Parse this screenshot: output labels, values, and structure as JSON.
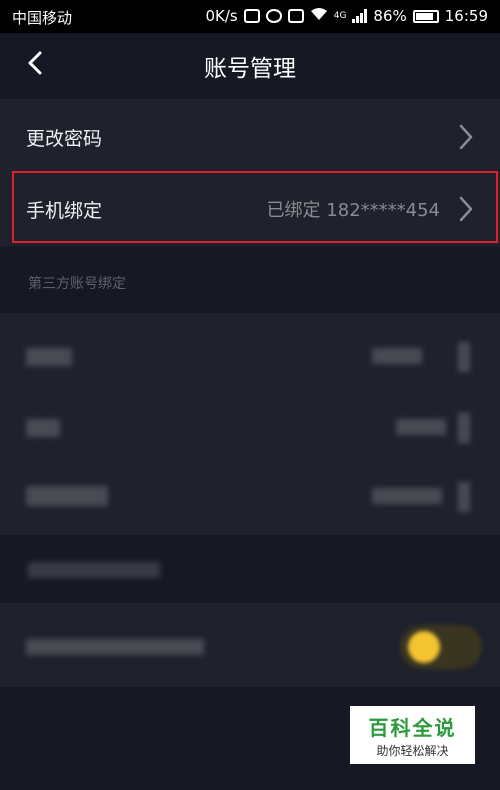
{
  "status_bar": {
    "carrier": "中国移动",
    "network_speed": "0K/s",
    "network_badge": "4G",
    "battery": "86%",
    "time": "16:59"
  },
  "nav": {
    "title": "账号管理",
    "back_icon": "chevron-left-icon"
  },
  "account_settings": {
    "change_password_label": "更改密码",
    "phone_binding_label": "手机绑定",
    "phone_binding_value": "已绑定 182*****454"
  },
  "third_party_section": {
    "title": "第三方账号绑定"
  },
  "watermark": {
    "main": "百科全说",
    "sub": "助你轻松解决"
  },
  "colors": {
    "background": "#161823",
    "row_background": "#1f212c",
    "highlight_border": "#e0202a",
    "watermark_green": "#2a9a3a"
  }
}
